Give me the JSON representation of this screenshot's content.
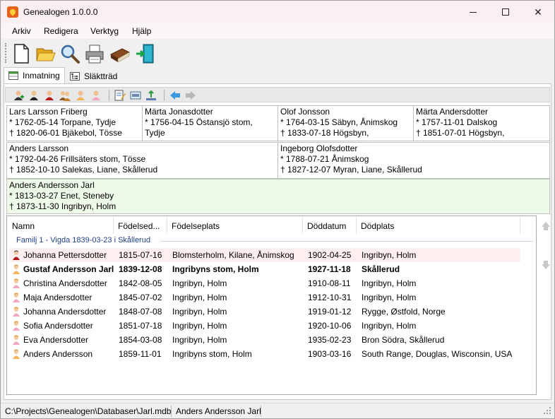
{
  "window": {
    "title": "Genealogen 1.0.0.0"
  },
  "menu": [
    "Arkiv",
    "Redigera",
    "Verktyg",
    "Hjälp"
  ],
  "tabs": [
    {
      "label": "Inmatning",
      "active": true
    },
    {
      "label": "Släktträd",
      "active": false
    }
  ],
  "grandparents": [
    {
      "name": "Lars Larsson Friberg",
      "born": "* 1762-05-14 Torpane, Tydje",
      "died": "† 1820-06-01 Bjäkebol, Tösse"
    },
    {
      "name": "Märta Jonasdotter",
      "born": "* 1756-04-15 Östansjö stom,",
      "died": "Tydje"
    },
    {
      "name": "Olof Jonsson",
      "born": "* 1764-03-15 Säbyn, Ånimskog",
      "died": "† 1833-07-18 Högsbyn,"
    },
    {
      "name": "Märta Andersdotter",
      "born": "* 1757-11-01 Dalskog",
      "died": "† 1851-07-01 Högsbyn,"
    }
  ],
  "parents": [
    {
      "name": "Anders Larsson",
      "born": "* 1792-04-26 Frillsäters stom, Tösse",
      "died": "† 1852-10-10 Salekas, Liane, Skållerud"
    },
    {
      "name": "Ingeborg Olofsdotter",
      "born": "* 1788-07-21 Ånimskog",
      "died": "† 1827-12-07 Myran, Liane, Skållerud"
    }
  ],
  "person": {
    "name": "Anders Andersson Jarl",
    "born": "* 1813-03-27 Enet, Steneby",
    "died": "† 1873-11-30 Ingribyn, Holm"
  },
  "list": {
    "columns": [
      "Namn",
      "Födelsed...",
      "Födelseplats",
      "Döddatum",
      "Dödplats"
    ],
    "family_label": "Familj 1 - Vigda 1839-03-23 i Skållerud",
    "rows": [
      {
        "icon": "female-dark-person-icon",
        "name": "Johanna Pettersdotter",
        "born": "1815-07-16",
        "birthplace": "Blomsterholm, Kilane, Ånimskog",
        "died": "1902-04-25",
        "deathplace": "Ingribyn, Holm",
        "highlight": true,
        "bold": false
      },
      {
        "icon": "male-person-icon",
        "name": "Gustaf Andersson Jarl",
        "born": "1839-12-08",
        "birthplace": "Ingribyns stom, Holm",
        "died": "1927-11-18",
        "deathplace": "Skållerud",
        "highlight": false,
        "bold": true
      },
      {
        "icon": "female-person-icon",
        "name": "Christina Andersdotter",
        "born": "1842-08-05",
        "birthplace": "Ingribyn, Holm",
        "died": "1910-08-11",
        "deathplace": "Ingribyn, Holm",
        "highlight": false,
        "bold": false
      },
      {
        "icon": "female-person-icon",
        "name": "Maja Andersdotter",
        "born": "1845-07-02",
        "birthplace": "Ingribyn, Holm",
        "died": "1912-10-31",
        "deathplace": "Ingribyn, Holm",
        "highlight": false,
        "bold": false
      },
      {
        "icon": "female-person-icon",
        "name": "Johanna Andersdotter",
        "born": "1848-07-08",
        "birthplace": "Ingribyn, Holm",
        "died": "1919-01-12",
        "deathplace": "Rygge, Østfold, Norge",
        "highlight": false,
        "bold": false
      },
      {
        "icon": "female-person-icon",
        "name": "Sofia Andersdotter",
        "born": "1851-07-18",
        "birthplace": "Ingribyn, Holm",
        "died": "1920-10-06",
        "deathplace": "Ingribyn, Holm",
        "highlight": false,
        "bold": false
      },
      {
        "icon": "female-person-icon",
        "name": "Eva Andersdotter",
        "born": "1854-03-08",
        "birthplace": "Ingribyn, Holm",
        "died": "1935-02-23",
        "deathplace": "Bron Södra, Skållerud",
        "highlight": false,
        "bold": false
      },
      {
        "icon": "male-person-icon",
        "name": "Anders Andersson",
        "born": "1859-11-01",
        "birthplace": "Ingribyns stom, Holm",
        "died": "1903-03-16",
        "deathplace": "South Range, Douglas, Wisconsin, USA",
        "highlight": false,
        "bold": false
      }
    ]
  },
  "status": {
    "path": "C:\\Projects\\Genealogen\\Databaser\\Jarl.mdb",
    "person": "Anders Andersson Jarl"
  },
  "colors": {
    "female": "#f2a7bf",
    "male": "#f3b35a",
    "highlight_row": "#fdeef0",
    "current_person": "#eefbe9",
    "family_label": "#1f3f8f"
  }
}
